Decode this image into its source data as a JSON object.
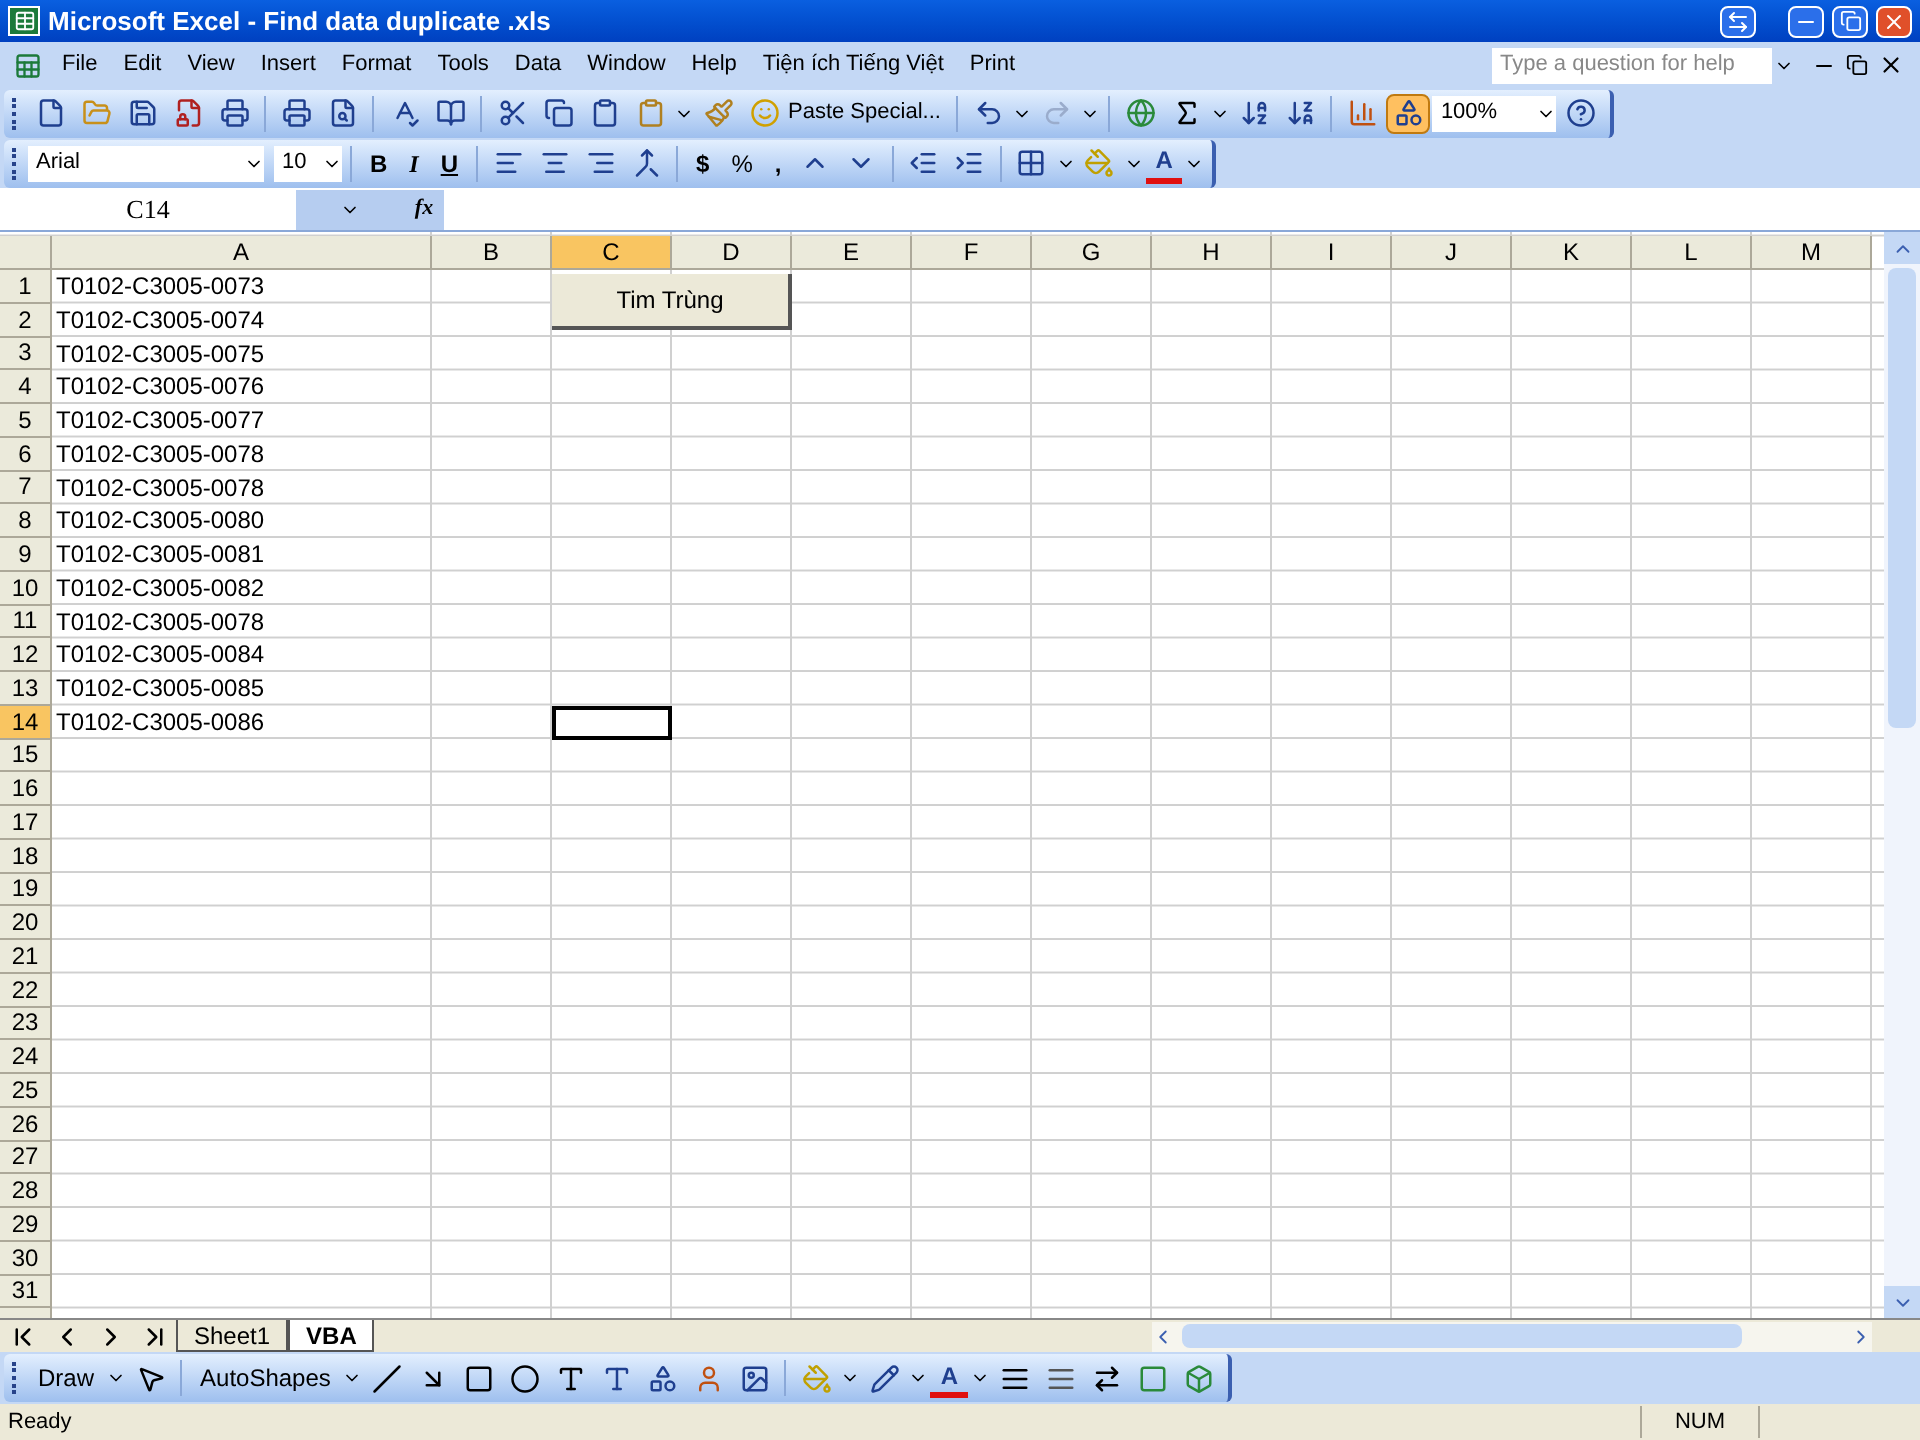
{
  "window": {
    "title": "Microsoft Excel - Find data duplicate .xls"
  },
  "menu": [
    "File",
    "Edit",
    "View",
    "Insert",
    "Format",
    "Tools",
    "Data",
    "Window",
    "Help",
    "Tiện ích Tiếng Việt",
    "Print"
  ],
  "help_box": {
    "placeholder": "Type a question for help"
  },
  "standard_toolbar": {
    "paste_special": "Paste Special...",
    "zoom": "100%"
  },
  "formatting_toolbar": {
    "font": "Arial",
    "size": "10",
    "bold": "B",
    "italic": "I",
    "underline": "U",
    "currency": "$",
    "percent": "%",
    "comma": ",",
    "font_color": "A"
  },
  "formula_bar": {
    "name_box": "C14",
    "function_label": "fx"
  },
  "sheet": {
    "columns": [
      {
        "label": "A",
        "selected": false
      },
      {
        "label": "B",
        "selected": false
      },
      {
        "label": "C",
        "selected": true
      },
      {
        "label": "D",
        "selected": false
      },
      {
        "label": "E",
        "selected": false
      },
      {
        "label": "F",
        "selected": false
      },
      {
        "label": "G",
        "selected": false
      },
      {
        "label": "H",
        "selected": false
      },
      {
        "label": "I",
        "selected": false
      },
      {
        "label": "J",
        "selected": false
      },
      {
        "label": "K",
        "selected": false
      },
      {
        "label": "L",
        "selected": false
      },
      {
        "label": "M",
        "selected": false
      }
    ],
    "rows": [
      {
        "label": "1",
        "selected": false,
        "value": "T0102-C3005-0073"
      },
      {
        "label": "2",
        "selected": false,
        "value": "T0102-C3005-0074"
      },
      {
        "label": "3",
        "selected": false,
        "value": "T0102-C3005-0075"
      },
      {
        "label": "4",
        "selected": false,
        "value": "T0102-C3005-0076"
      },
      {
        "label": "5",
        "selected": false,
        "value": "T0102-C3005-0077"
      },
      {
        "label": "6",
        "selected": false,
        "value": "T0102-C3005-0078"
      },
      {
        "label": "7",
        "selected": false,
        "value": "T0102-C3005-0078"
      },
      {
        "label": "8",
        "selected": false,
        "value": "T0102-C3005-0080"
      },
      {
        "label": "9",
        "selected": false,
        "value": "T0102-C3005-0081"
      },
      {
        "label": "10",
        "selected": false,
        "value": "T0102-C3005-0082"
      },
      {
        "label": "11",
        "selected": false,
        "value": "T0102-C3005-0078"
      },
      {
        "label": "12",
        "selected": false,
        "value": "T0102-C3005-0084"
      },
      {
        "label": "13",
        "selected": false,
        "value": "T0102-C3005-0085"
      },
      {
        "label": "14",
        "selected": true,
        "value": "T0102-C3005-0086"
      },
      {
        "label": "15",
        "selected": false
      },
      {
        "label": "16",
        "selected": false
      },
      {
        "label": "17",
        "selected": false
      },
      {
        "label": "18",
        "selected": false
      },
      {
        "label": "19",
        "selected": false
      },
      {
        "label": "20",
        "selected": false
      },
      {
        "label": "21",
        "selected": false
      },
      {
        "label": "22",
        "selected": false
      },
      {
        "label": "23",
        "selected": false
      },
      {
        "label": "24",
        "selected": false
      },
      {
        "label": "25",
        "selected": false
      },
      {
        "label": "26",
        "selected": false
      },
      {
        "label": "27",
        "selected": false
      },
      {
        "label": "28",
        "selected": false
      },
      {
        "label": "29",
        "selected": false
      },
      {
        "label": "30",
        "selected": false
      },
      {
        "label": "31",
        "selected": false
      }
    ],
    "button": "Tim Trùng"
  },
  "sheet_tabs": [
    {
      "label": "Sheet1",
      "selected": false
    },
    {
      "label": "VBA",
      "selected": true
    }
  ],
  "drawing_toolbar": {
    "draw": "Draw",
    "autoshapes": "AutoShapes",
    "font_color": "A"
  },
  "status_bar": {
    "status": "Ready",
    "indicators": [
      "NUM"
    ]
  }
}
